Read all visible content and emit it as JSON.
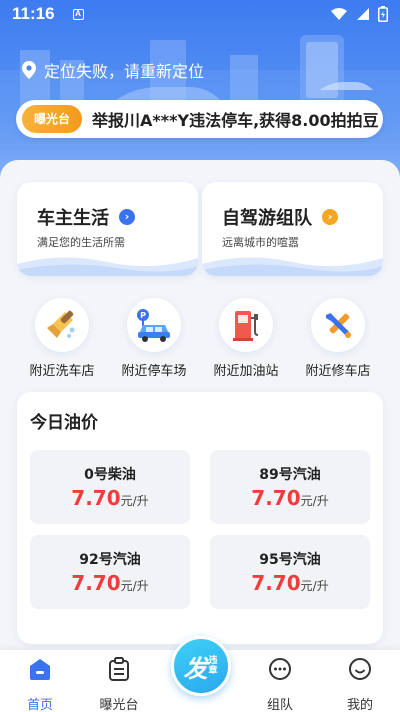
{
  "status_bar": {
    "time": "11:16",
    "notification_icon": "A"
  },
  "header": {
    "location_text": "定位失败，请重新定位"
  },
  "ticker": {
    "badge": "曝光台",
    "message": "举报川A***Y违法停车,获得8.00拍拍豆"
  },
  "features": [
    {
      "title": "车主生活",
      "subtitle": "满足您的生活所需",
      "accent": "#3a72f0"
    },
    {
      "title": "自驾游组队",
      "subtitle": "远离城市的喧嚣",
      "accent": "#f5a623"
    }
  ],
  "shortcuts": [
    {
      "label": "附近洗车店",
      "icon": "car-wash-icon"
    },
    {
      "label": "附近停车场",
      "icon": "parking-icon"
    },
    {
      "label": "附近加油站",
      "icon": "gas-station-icon"
    },
    {
      "label": "附近修车店",
      "icon": "repair-icon"
    }
  ],
  "oil": {
    "title": "今日油价",
    "unit": "元/升",
    "items": [
      {
        "name": "0号柴油",
        "price": "7.70"
      },
      {
        "name": "89号汽油",
        "price": "7.70"
      },
      {
        "name": "92号汽油",
        "price": "7.70"
      },
      {
        "name": "95号汽油",
        "price": "7.70"
      }
    ]
  },
  "tabbar": {
    "home": "首页",
    "exposure": "曝光台",
    "fab_main": "发",
    "fab_sub": "违章",
    "team": "组队",
    "mine": "我的"
  },
  "colors": {
    "primary": "#3a72f0",
    "price": "#f03c3c",
    "badge": "#f5a623"
  }
}
